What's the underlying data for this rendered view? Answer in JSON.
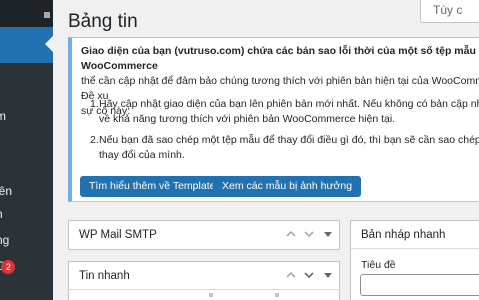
{
  "sidebar": {
    "items": [
      {
        "label": "m",
        "badge": ""
      },
      {
        "label": "iên",
        "badge": ""
      },
      {
        "label": "n",
        "badge": ""
      },
      {
        "label": "ng",
        "badge": ""
      },
      {
        "label": "O",
        "badge": "2"
      }
    ]
  },
  "header": {
    "title": "Bảng tin",
    "screen_options": "Tùy c"
  },
  "notice": {
    "lead_bold": "Giao diện của bạn (vutruso.com) chứa các bản sao lỗi thời của một số tệp mẫu WooCommerce",
    "lead_rest": "thể cần cập nhật để đảm bảo chúng tương thích với phiên bản hiện tại của WooCommerce. Đề xu",
    "lead_end": "sự cố này:",
    "steps": [
      {
        "num": "1.",
        "line1": "Hãy cập nhật giao diện của bạn lên phiên bản mới nhất. Nếu không có bản cập nhật, hãy liên",
        "line2": "về khả năng tương thích với phiên bản WooCommerce hiện tại."
      },
      {
        "num": "2.",
        "line1": "Nếu bạn đã sao chép một tệp mẫu để thay đổi điều gì đó, thì bạn sẽ cần sao chép phiên bản",
        "line2": "thay đổi của mình."
      }
    ],
    "btn_learn_more": "Tìm hiểu thêm về Template",
    "btn_view_affected": "Xem các mẫu bị ảnh hưởng"
  },
  "widgets": {
    "wp_mail_smtp": {
      "title": "WP Mail SMTP"
    },
    "tin_nhanh": {
      "title": "Tin nhanh"
    },
    "quick_draft": {
      "title": "Bản nháp nhanh",
      "title_label": "Tiêu đề"
    }
  },
  "colors": {
    "sidebar_bg": "#1d2327",
    "accent": "#2271b1",
    "notice_border": "#72aee6",
    "badge": "#d63638"
  }
}
